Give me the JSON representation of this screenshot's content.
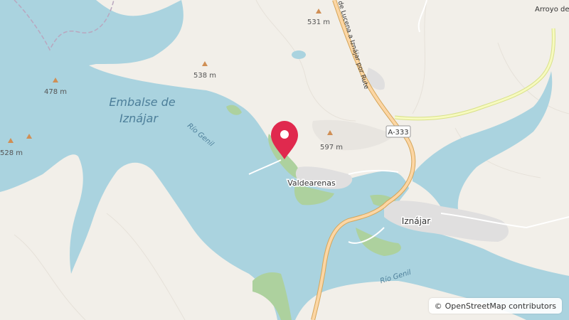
{
  "map": {
    "colors": {
      "land": "#f2efe9",
      "water": "#aad3df",
      "wood": "#add19e",
      "residential": "#e0dfdf",
      "primary_road": "#fcd6a4",
      "secondary_road": "#f7fabf",
      "marker": "#e0294e"
    },
    "labels": {
      "reservoir": [
        "Embalse de",
        "Iznájar"
      ],
      "river_upper": "Río Genil",
      "river_lower": "Río Genil",
      "village": "Valdearenas",
      "town": "Iznájar",
      "road_ref": "A-333",
      "road_name": "a de Lucena a Iznájar por Rute",
      "stream": "Arroyo de"
    },
    "peaks": [
      {
        "label": "531 m"
      },
      {
        "label": "538 m"
      },
      {
        "label": "478 m"
      },
      {
        "label": "528 m"
      },
      {
        "label": "597 m"
      }
    ],
    "marker_icon": "map-pin-icon",
    "attribution": {
      "symbol": "©",
      "text": "OpenStreetMap contributors"
    }
  }
}
